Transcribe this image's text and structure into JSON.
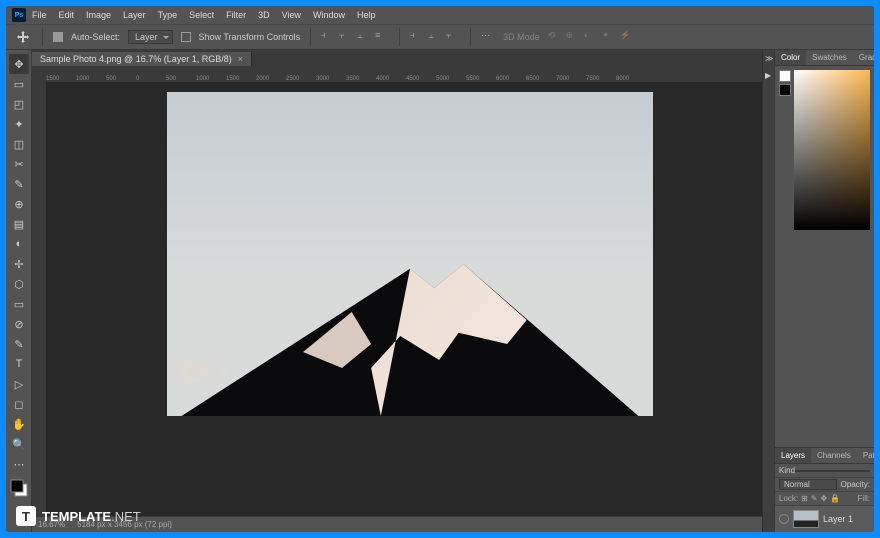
{
  "menu": [
    "File",
    "Edit",
    "Image",
    "Layer",
    "Type",
    "Select",
    "Filter",
    "3D",
    "View",
    "Window",
    "Help"
  ],
  "options": {
    "auto_select": "Auto-Select:",
    "layer": "Layer",
    "transform": "Show Transform Controls",
    "threед": "3D Mode"
  },
  "tab": {
    "title": "Sample Photo 4.png @ 16.7% (Layer 1, RGB/8)"
  },
  "ruler_marks": [
    "1500",
    "1000",
    "500",
    "0",
    "500",
    "1000",
    "1500",
    "2000",
    "2500",
    "3000",
    "3500",
    "4000",
    "4500",
    "5000",
    "5500",
    "6000",
    "6500",
    "7000",
    "7500",
    "8000"
  ],
  "panels": {
    "color_tabs": [
      "Color",
      "Swatches",
      "Gradients"
    ],
    "layers_tabs": [
      "Layers",
      "Channels",
      "Paths"
    ],
    "kind": "Kind",
    "blend": "Normal",
    "opacity": "Opacity:",
    "lock": "Lock:",
    "fill": "Fill:",
    "layer_name": "Layer 1"
  },
  "status": {
    "zoom": "16.67%",
    "dims": "5184 px x 3456 px (72 ppi)"
  },
  "watermark": {
    "bold": "TEMPLATE",
    "light": ".NET"
  },
  "tool_glyphs": [
    "✥",
    "▭",
    "◰",
    "✦",
    "◫",
    "✂",
    "✎",
    "⊕",
    "▤",
    "◐",
    "✢",
    "⬡",
    "▭",
    "⊘",
    "✎",
    "T",
    "▷",
    "◻",
    "✋",
    "🔍",
    "⋯"
  ]
}
